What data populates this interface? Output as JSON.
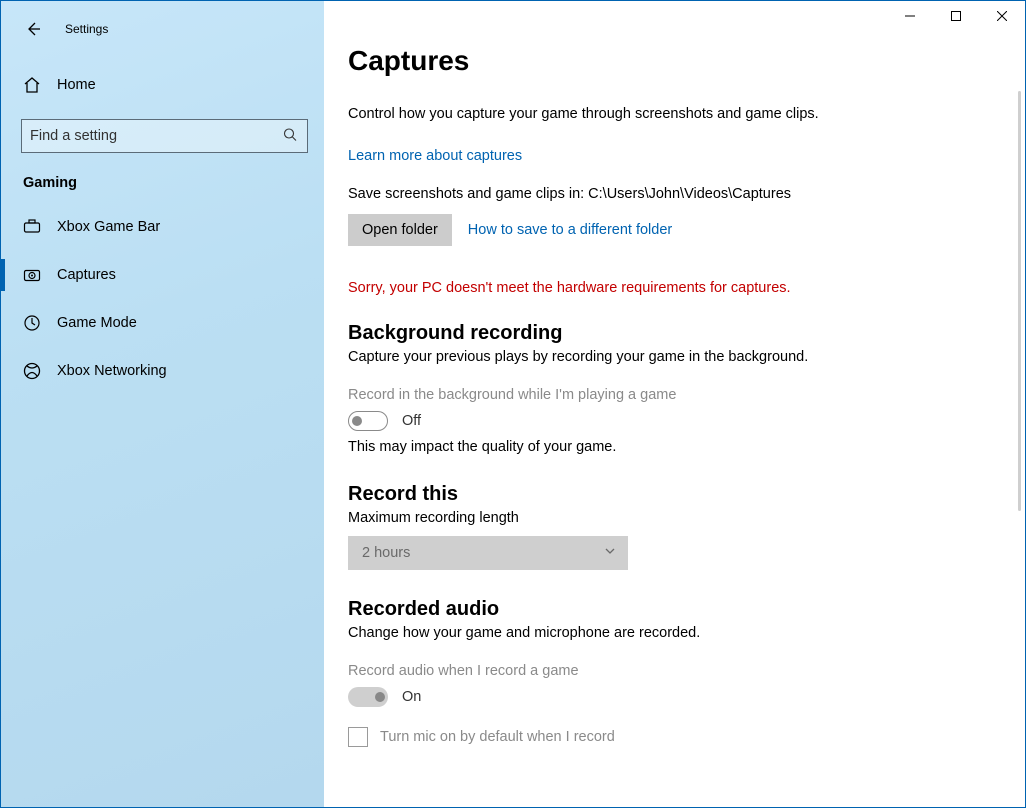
{
  "titlebar": {
    "app_name": "Settings"
  },
  "sidebar": {
    "home_label": "Home",
    "search_placeholder": "Find a setting",
    "section_label": "Gaming",
    "items": [
      {
        "id": "xbox-game-bar",
        "label": "Xbox Game Bar"
      },
      {
        "id": "captures",
        "label": "Captures"
      },
      {
        "id": "game-mode",
        "label": "Game Mode"
      },
      {
        "id": "xbox-networking",
        "label": "Xbox Networking"
      }
    ]
  },
  "main": {
    "title": "Captures",
    "intro": "Control how you capture your game through screenshots and game clips.",
    "learn_more": "Learn more about captures",
    "save_path_label": "Save screenshots and game clips in: C:\\Users\\John\\Videos\\Captures",
    "open_folder_btn": "Open folder",
    "how_to_save_link": "How to save to a different folder",
    "error": "Sorry, your PC doesn't meet the hardware requirements for captures.",
    "bg": {
      "heading": "Background recording",
      "desc": "Capture your previous plays by recording your game in the background.",
      "toggle_label": "Record in the background while I'm playing a game",
      "toggle_state": "Off",
      "impact": "This may impact the quality of your game."
    },
    "record_this": {
      "heading": "Record this",
      "label": "Maximum recording length",
      "value": "2 hours"
    },
    "audio": {
      "heading": "Recorded audio",
      "desc": "Change how your game and microphone are recorded.",
      "toggle_label": "Record audio when I record a game",
      "toggle_state": "On",
      "mic_check_label": "Turn mic on by default when I record"
    }
  }
}
